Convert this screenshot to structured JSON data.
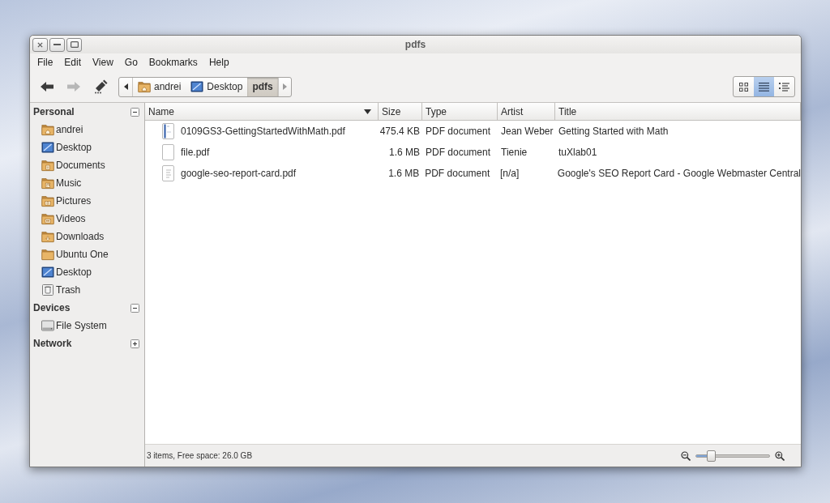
{
  "window": {
    "title": "pdfs",
    "controls": [
      {
        "kind": "close"
      },
      {
        "kind": "minimize"
      },
      {
        "kind": "maximize"
      }
    ]
  },
  "menu_bar": [
    "File",
    "Edit",
    "View",
    "Go",
    "Bookmarks",
    "Help"
  ],
  "toolbar": {
    "buttons": [
      {
        "kind": "back",
        "disabled": false
      },
      {
        "kind": "forward",
        "disabled": true
      },
      {
        "kind": "edit",
        "disabled": false
      }
    ],
    "path_bar": {
      "crumbs": [
        {
          "label": "andrei",
          "kind": "home",
          "selected": false
        },
        {
          "label": "Desktop",
          "kind": "desktop",
          "selected": false
        },
        {
          "label": "pdfs",
          "kind": "plain",
          "selected": true
        }
      ]
    },
    "view_modes": [
      {
        "kind": "icons",
        "selected": false
      },
      {
        "kind": "list",
        "selected": true
      },
      {
        "kind": "compact",
        "selected": false
      }
    ]
  },
  "sidebar": {
    "sections": [
      {
        "title": "Personal",
        "expanded": true,
        "items": [
          {
            "label": "andrei",
            "kind": "home"
          },
          {
            "label": "Desktop",
            "kind": "desktop"
          },
          {
            "label": "Documents",
            "kind": "documents"
          },
          {
            "label": "Music",
            "kind": "music"
          },
          {
            "label": "Pictures",
            "kind": "pictures"
          },
          {
            "label": "Videos",
            "kind": "videos"
          },
          {
            "label": "Downloads",
            "kind": "downloads"
          },
          {
            "label": "Ubuntu One",
            "kind": "folder"
          },
          {
            "label": "Desktop",
            "kind": "desktop"
          },
          {
            "label": "Trash",
            "kind": "trash"
          }
        ]
      },
      {
        "title": "Devices",
        "expanded": true,
        "items": [
          {
            "label": "File System",
            "kind": "drive"
          }
        ]
      },
      {
        "title": "Network",
        "expanded": false
      }
    ]
  },
  "table": {
    "columns": [
      {
        "label": "Name",
        "sorted": true
      },
      {
        "label": "Size",
        "sorted": false
      },
      {
        "label": "Type",
        "sorted": false
      },
      {
        "label": "Artist",
        "sorted": false
      },
      {
        "label": "Title",
        "sorted": false
      }
    ],
    "rows": [
      {
        "kind": "cover",
        "cells": [
          "0109GS3-GettingStartedWithMath.pdf",
          "475.4 KB",
          "PDF document",
          "Jean Weber",
          "Getting Started with Math"
        ]
      },
      {
        "kind": "blank",
        "cells": [
          "file.pdf",
          "1.6 MB",
          "PDF document",
          "Tienie",
          "tuXlab01"
        ]
      },
      {
        "kind": "text",
        "cells": [
          "google-seo-report-card.pdf",
          "1.6 MB",
          "PDF document",
          "[n/a]",
          "Google's SEO Report Card - Google Webmaster Central"
        ]
      }
    ]
  },
  "status_bar": {
    "text": "3 items, Free space: 26.0 GB",
    "zoom": {
      "level": 0.2
    }
  }
}
